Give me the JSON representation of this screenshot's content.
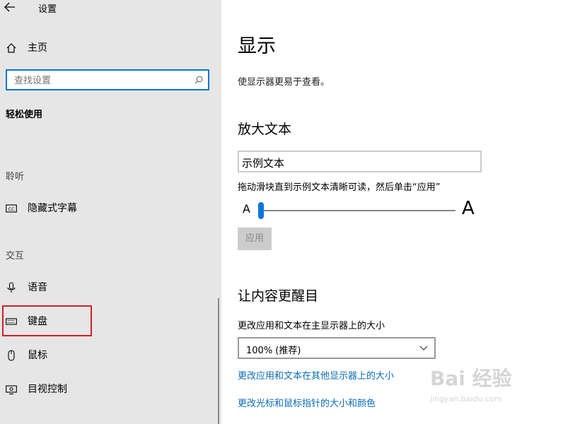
{
  "window": {
    "title": "设置"
  },
  "sidebar": {
    "home_label": "主页",
    "search": {
      "placeholder": "查找设置"
    },
    "category": "轻松使用",
    "sections": {
      "hearing": "聆听",
      "interaction": "交互"
    },
    "items": {
      "captions": "隐藏式字幕",
      "speech": "语音",
      "keyboard": "键盘",
      "mouse": "鼠标",
      "eye_control": "目视控制"
    }
  },
  "main": {
    "title": "显示",
    "description": "使显示器更易于查看。",
    "enlarge_text": {
      "heading": "放大文本",
      "sample_text": "示例文本",
      "instruction": "拖动滑块直到示例文本清晰可读，然后单击“应用”",
      "small_a": "A",
      "large_a": "A",
      "apply_label": "应用",
      "slider_level": 0.0
    },
    "make_bigger": {
      "heading": "让内容更醒目",
      "size_label": "更改应用和文本在主显示器上的大小",
      "dropdown_value": "100% (推荐)",
      "link_other_displays": "更改应用和文本在其他显示器上的大小",
      "link_cursor": "更改光标和鼠标指针的大小和颜色"
    }
  },
  "watermark": {
    "brand": "Bai 经验",
    "url": "jingyan.baidu.com"
  },
  "colors": {
    "accent": "#0078d7",
    "link": "#0a6cb8",
    "highlight": "#d0202a"
  }
}
